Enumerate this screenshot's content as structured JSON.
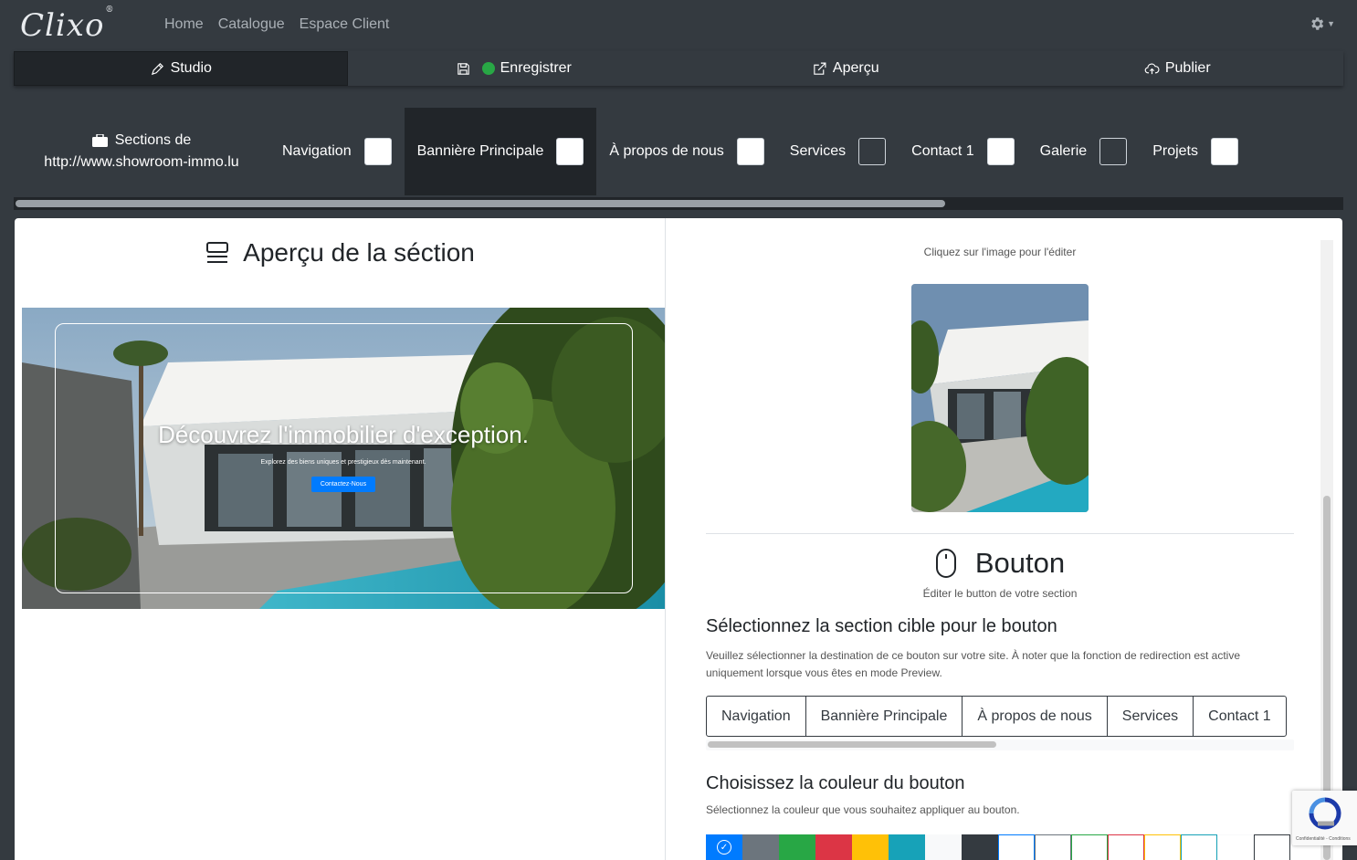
{
  "app": {
    "logo": "Clixo"
  },
  "nav": {
    "links": [
      "Home",
      "Catalogue",
      "Espace Client"
    ]
  },
  "toolbar": {
    "studio": "Studio",
    "save": "Enregistrer",
    "preview": "Aperçu",
    "publish": "Publier"
  },
  "sections": {
    "title_line1": "Sections de",
    "title_line2": "http://www.showroom-immo.lu",
    "items": [
      {
        "label": "Navigation",
        "checked": true
      },
      {
        "label": "Bannière Principale",
        "checked": true,
        "active": true
      },
      {
        "label": "À propos de nous",
        "checked": true
      },
      {
        "label": "Services",
        "checked": false
      },
      {
        "label": "Contact 1",
        "checked": true
      },
      {
        "label": "Galerie",
        "checked": false
      },
      {
        "label": "Projets",
        "checked": true
      }
    ]
  },
  "preview": {
    "heading": "Aperçu de la séction",
    "banner_title": "Découvrez l'immobilier d'exception.",
    "banner_subtitle": "Explorez des biens uniques et prestigieux dès maintenant.",
    "banner_button": "Contactez-Nous"
  },
  "editor": {
    "image_caption": "Cliquez sur l'image pour l'éditer",
    "button_heading": "Bouton",
    "button_caption": "Éditer le button de votre section",
    "target_heading": "Sélectionnez la section cible pour le bouton",
    "target_text": "Veuillez sélectionner la destination de ce bouton sur votre site. À noter que la fonction de redirection est active uniquement lorsque vous êtes en mode Preview.",
    "targets": [
      "Navigation",
      "Bannière Principale",
      "À propos de nous",
      "Services",
      "Contact 1"
    ],
    "color_heading": "Choisissez la couleur du bouton",
    "color_text": "Sélectionnez la couleur que vous souhaitez appliquer au bouton.",
    "colors": [
      "#007bff",
      "#6c757d",
      "#28a745",
      "#dc3545",
      "#ffc107",
      "#17a2b8",
      "#f8f9fa",
      "#343a40"
    ],
    "outline_colors": [
      "#007bff",
      "#6c757d",
      "#28a745",
      "#dc3545",
      "#ffc107",
      "#17a2b8",
      "#f8f9fa",
      "#343a40"
    ]
  },
  "recaptcha": {
    "text": "Confidentialité - Conditions"
  }
}
